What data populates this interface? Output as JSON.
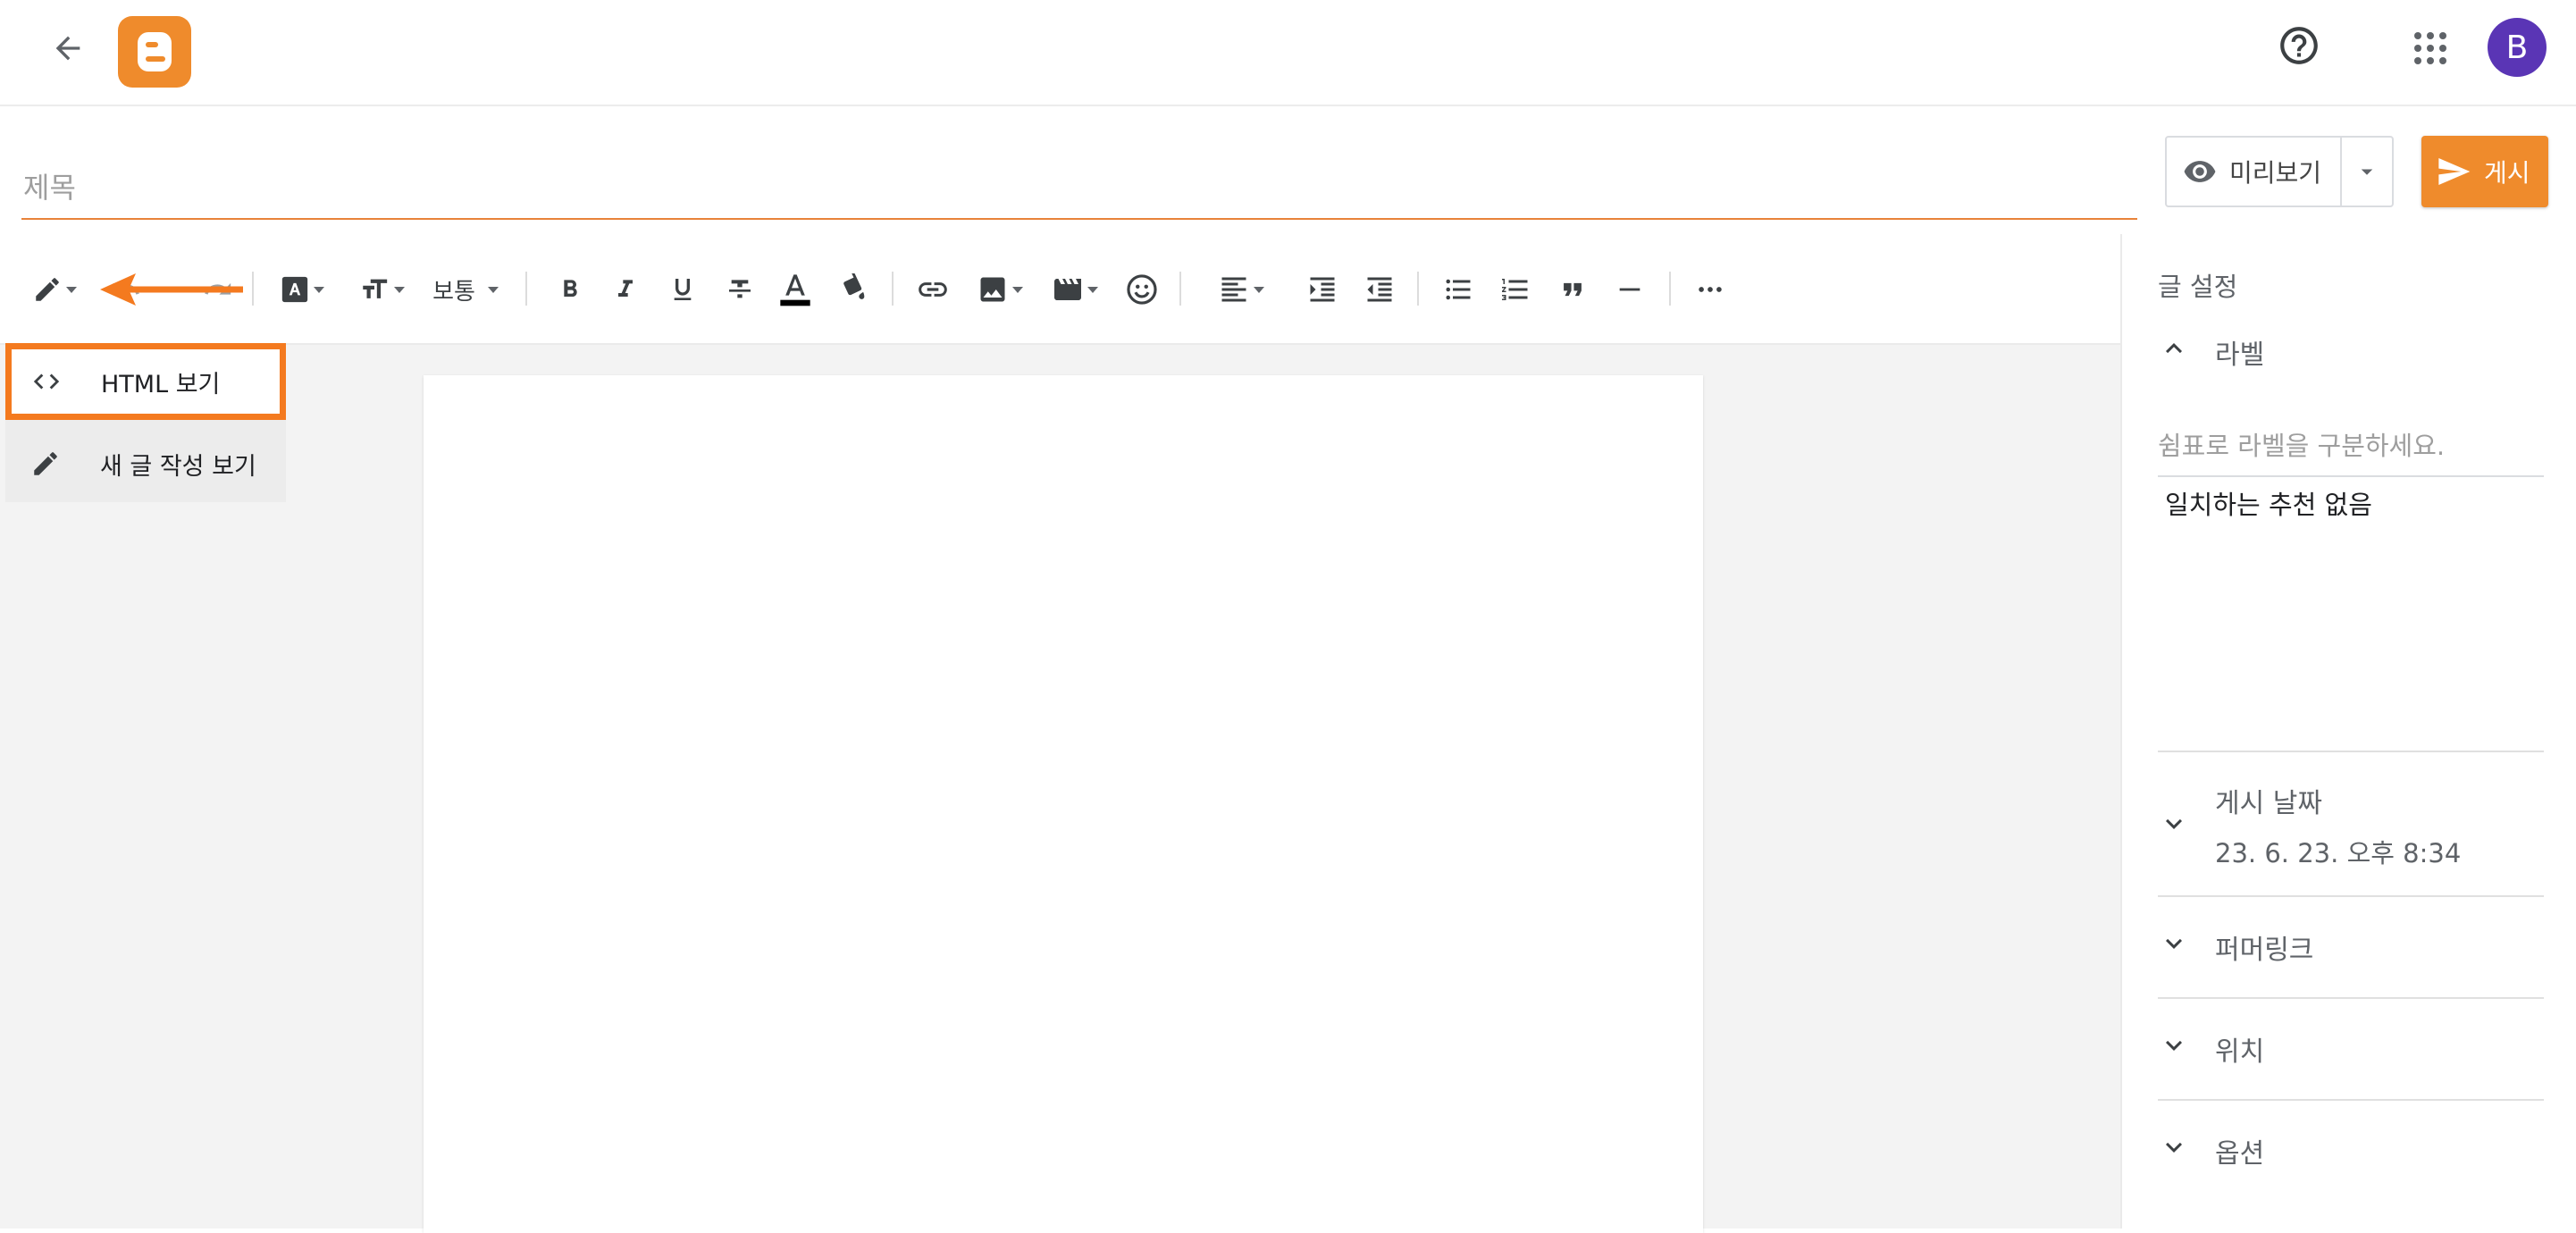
{
  "header": {
    "avatar_letter": "B",
    "brand_color": "#ef8b2c",
    "avatar_color": "#5a35b5"
  },
  "title_field": {
    "placeholder": "제목",
    "value": ""
  },
  "actions": {
    "preview_label": "미리보기",
    "publish_label": "게시"
  },
  "toolbar": {
    "paragraph_style": "보통",
    "icons": [
      "pencil-icon",
      "undo-icon",
      "redo-icon",
      "font-icon",
      "text-size-icon",
      "bold-icon",
      "italic-icon",
      "underline-icon",
      "strikethrough-icon",
      "text-color-icon",
      "highlight-icon",
      "link-icon",
      "image-icon",
      "video-icon",
      "emoji-icon",
      "align-icon",
      "indent-icon",
      "outdent-icon",
      "bulleted-list-icon",
      "numbered-list-icon",
      "quote-icon",
      "horizontal-rule-icon",
      "more-icon"
    ]
  },
  "mode_menu": {
    "items": [
      {
        "label": "HTML 보기",
        "icon": "code-icon"
      },
      {
        "label": "새 글 작성 보기",
        "icon": "pencil-icon"
      }
    ]
  },
  "sidebar": {
    "heading": "글 설정",
    "labels": {
      "title": "라벨",
      "input_placeholder": "쉼표로 라벨을 구분하세요.",
      "no_match": "일치하는 추천 없음"
    },
    "sections": [
      {
        "title": "게시 날짜",
        "value": "23. 6. 23. 오후 8:34"
      },
      {
        "title": "퍼머링크"
      },
      {
        "title": "위치"
      },
      {
        "title": "옵션"
      }
    ]
  },
  "highlight_color": "#f47a1f"
}
